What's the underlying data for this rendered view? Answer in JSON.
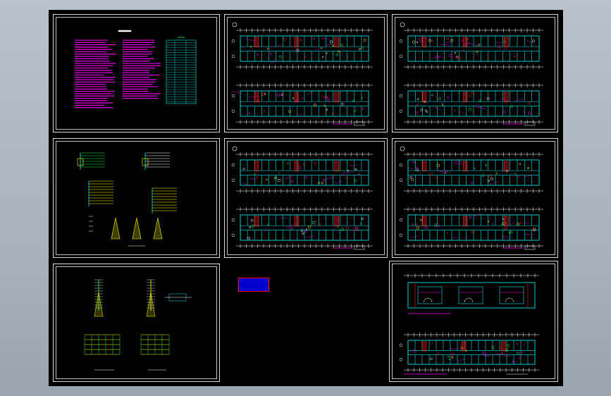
{
  "viewer": {
    "background_top": "#b9c2cc",
    "background_bottom": "#9aa4ae",
    "canvas_color": "#000000"
  },
  "sheets": [
    {
      "id": "design-notes",
      "kind": "notes"
    },
    {
      "id": "floor-plan-1",
      "kind": "plan"
    },
    {
      "id": "floor-plan-2",
      "kind": "plan"
    },
    {
      "id": "system-diagram-1",
      "kind": "diagram"
    },
    {
      "id": "floor-plan-3",
      "kind": "plan"
    },
    {
      "id": "floor-plan-4",
      "kind": "plan"
    },
    {
      "id": "system-diagram-2",
      "kind": "diagram"
    },
    {
      "id": "floor-plan-5",
      "kind": "plan"
    }
  ],
  "stamp": {
    "text": "",
    "fill": "#0000cc",
    "border": "#ff0000"
  },
  "palette": {
    "cyan": "#00e5e5",
    "magenta": "#ff00ff",
    "yellow": "#ffff00",
    "white": "#ffffff",
    "red": "#ff2020",
    "green": "#00ff40"
  }
}
